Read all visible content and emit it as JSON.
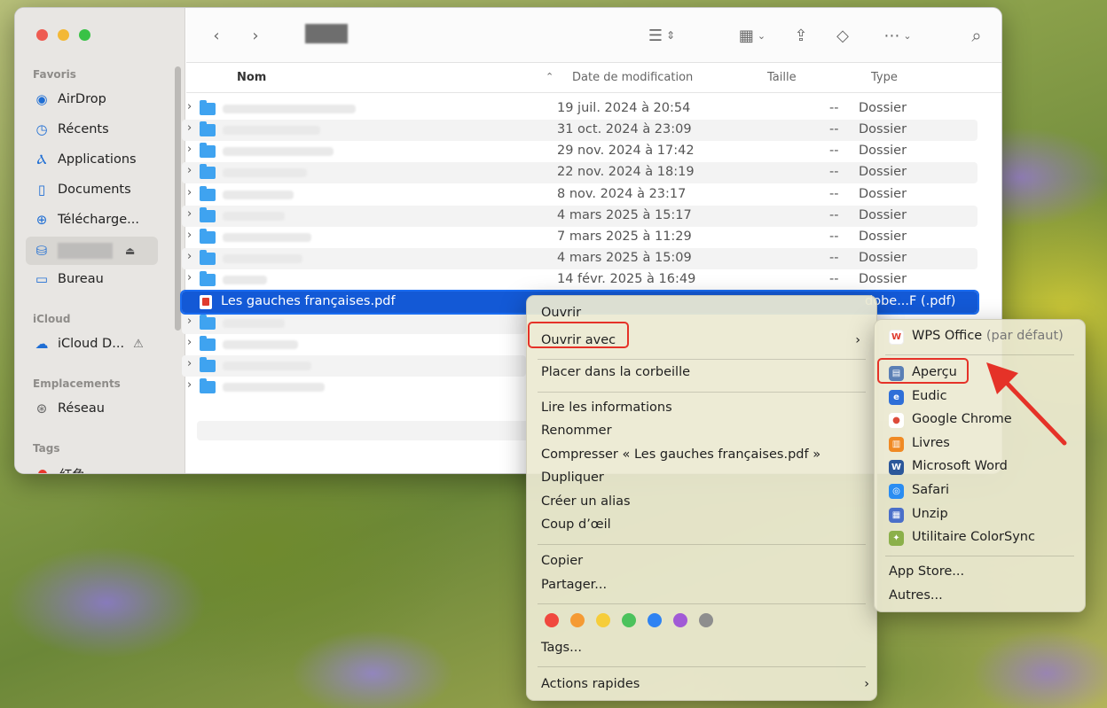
{
  "sidebar": {
    "sections": {
      "favorites": "Favoris",
      "icloud": "iCloud",
      "locations": "Emplacements",
      "tags": "Tags"
    },
    "items": [
      {
        "label": "AirDrop",
        "icon": "airdrop-icon"
      },
      {
        "label": "Récents",
        "icon": "clock-icon"
      },
      {
        "label": "Applications",
        "icon": "applications-icon"
      },
      {
        "label": "Documents",
        "icon": "document-icon"
      },
      {
        "label": "Télécharge...",
        "icon": "download-icon"
      },
      {
        "label": "Bureau",
        "icon": "desktop-icon"
      }
    ],
    "icloud_item": "iCloud D...",
    "network_item": "Réseau",
    "tag_item": "红色",
    "tag_color": "#e8392f"
  },
  "toolbar": {
    "view_glyph": "☰",
    "group_glyph": "▦",
    "share_glyph": "⇪",
    "tag_glyph": "◇",
    "more_glyph": "⋯",
    "search_glyph": "⌕"
  },
  "columns": {
    "name": "Nom",
    "date": "Date de modification",
    "size": "Taille",
    "type": "Type"
  },
  "rows": [
    {
      "date": "19 juil. 2024 à 20:54",
      "size": "--",
      "type": "Dossier"
    },
    {
      "date": "31 oct. 2024 à 23:09",
      "size": "--",
      "type": "Dossier"
    },
    {
      "date": "29 nov. 2024 à 17:42",
      "size": "--",
      "type": "Dossier"
    },
    {
      "date": "22 nov. 2024 à 18:19",
      "size": "--",
      "type": "Dossier"
    },
    {
      "date": "8 nov. 2024 à 23:17",
      "size": "--",
      "type": "Dossier"
    },
    {
      "date": "4 mars 2025 à 15:17",
      "size": "--",
      "type": "Dossier"
    },
    {
      "date": "7 mars 2025 à 11:29",
      "size": "--",
      "type": "Dossier"
    },
    {
      "date": "4 mars 2025 à 15:09",
      "size": "--",
      "type": "Dossier"
    },
    {
      "date": "14 févr. 2025 à 16:49",
      "size": "--",
      "type": "Dossier"
    }
  ],
  "selected_file": {
    "name": "Les gauches françaises.pdf",
    "type": "dobe...F (.pdf)"
  },
  "context_menu": {
    "open": "Ouvrir",
    "open_with": "Ouvrir avec",
    "trash": "Placer dans la corbeille",
    "get_info": "Lire les informations",
    "rename": "Renommer",
    "compress": "Compresser « Les gauches françaises.pdf »",
    "duplicate": "Dupliquer",
    "alias": "Créer un alias",
    "quicklook": "Coup d’œil",
    "copy": "Copier",
    "share": "Partager...",
    "tags": "Tags...",
    "quick_actions": "Actions rapides",
    "tag_colors": [
      "#f0483e",
      "#f59a33",
      "#f6cd3a",
      "#4cc25c",
      "#2f83f2",
      "#a15ad6",
      "#8e8e8e"
    ]
  },
  "submenu": {
    "default_app": "WPS Office",
    "default_suffix": "(par défaut)",
    "apps": [
      "Aperçu",
      "Eudic",
      "Google Chrome",
      "Livres",
      "Microsoft Word",
      "Safari",
      "Unzip",
      "Utilitaire ColorSync"
    ],
    "app_store": "App Store...",
    "others": "Autres..."
  },
  "highlight_color": "#e53228"
}
